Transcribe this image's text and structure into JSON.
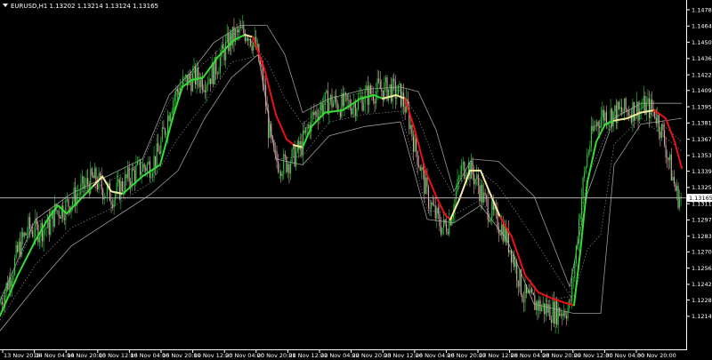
{
  "window": {
    "symbol_label": "EURUSD,H1  1.13202 1.13214 1.13124 1.13165"
  },
  "colors": {
    "background": "#000000",
    "axis": "#ffffff",
    "bull_candle": "#2ecc40",
    "bear_candle": "#d8a8a8",
    "trend_up": "#33dd33",
    "trend_flat": "#f2eca0",
    "trend_down": "#ee1111",
    "envelope": "#9a9a9a",
    "bid_line": "#b0b0b0"
  },
  "chart_data": {
    "type": "candlestick",
    "symbol": "EURUSD",
    "timeframe": "H1",
    "ohlc_header": {
      "open": 1.13202,
      "high": 1.13214,
      "low": 1.13124,
      "close": 1.13165
    },
    "price_ticks": [
      1.14785,
      1.14645,
      1.14505,
      1.14365,
      1.14225,
      1.1409,
      1.1395,
      1.1381,
      1.1367,
      1.1353,
      1.13395,
      1.13255,
      1.13115,
      1.12975,
      1.12835,
      1.127,
      1.1256,
      1.1242,
      1.12285,
      1.12145
    ],
    "time_labels": [
      "13 Nov 2018",
      "14 Nov 04:00",
      "14 Nov 20:00",
      "15 Nov 12:00",
      "16 Nov 04:00",
      "16 Nov 20:00",
      "19 Nov 12:00",
      "20 Nov 04:00",
      "20 Nov 20:00",
      "21 Nov 12:00",
      "22 Nov 04:00",
      "22 Nov 20:00",
      "23 Nov 12:00",
      "26 Nov 04:00",
      "26 Nov 20:00",
      "27 Nov 12:00",
      "28 Nov 04:00",
      "28 Nov 20:00",
      "29 Nov 12:00",
      "30 Nov 04:00",
      "30 Nov 20:00"
    ],
    "current_price": "1.13165",
    "close_path": [
      [
        0,
        1.1225
      ],
      [
        12,
        1.125
      ],
      [
        22,
        1.1275
      ],
      [
        32,
        1.129
      ],
      [
        40,
        1.1288
      ],
      [
        55,
        1.1292
      ],
      [
        62,
        1.1305
      ],
      [
        72,
        1.1308
      ],
      [
        85,
        1.1318
      ],
      [
        97,
        1.1328
      ],
      [
        105,
        1.1333
      ],
      [
        112,
        1.1328
      ],
      [
        118,
        1.1322
      ],
      [
        128,
        1.1318
      ],
      [
        140,
        1.133
      ],
      [
        150,
        1.1338
      ],
      [
        160,
        1.1343
      ],
      [
        170,
        1.1345
      ],
      [
        178,
        1.1355
      ],
      [
        185,
        1.1375
      ],
      [
        192,
        1.1398
      ],
      [
        200,
        1.141
      ],
      [
        210,
        1.1418
      ],
      [
        220,
        1.142
      ],
      [
        230,
        1.1418
      ],
      [
        240,
        1.1425
      ],
      [
        250,
        1.144
      ],
      [
        258,
        1.1452
      ],
      [
        268,
        1.1458
      ],
      [
        278,
        1.146
      ],
      [
        288,
        1.1445
      ],
      [
        296,
        1.1415
      ],
      [
        302,
        1.1375
      ],
      [
        308,
        1.135
      ],
      [
        318,
        1.1345
      ],
      [
        328,
        1.135
      ],
      [
        338,
        1.136
      ],
      [
        350,
        1.1385
      ],
      [
        360,
        1.1395
      ],
      [
        370,
        1.14
      ],
      [
        385,
        1.1396
      ],
      [
        400,
        1.1398
      ],
      [
        412,
        1.1405
      ],
      [
        425,
        1.141
      ],
      [
        438,
        1.141
      ],
      [
        450,
        1.1405
      ],
      [
        458,
        1.139
      ],
      [
        465,
        1.1365
      ],
      [
        472,
        1.1345
      ],
      [
        480,
        1.1318
      ],
      [
        490,
        1.13
      ],
      [
        498,
        1.129
      ],
      [
        505,
        1.1298
      ],
      [
        512,
        1.1318
      ],
      [
        518,
        1.134
      ],
      [
        525,
        1.1345
      ],
      [
        535,
        1.1332
      ],
      [
        545,
        1.1312
      ],
      [
        555,
        1.13
      ],
      [
        565,
        1.129
      ],
      [
        575,
        1.127
      ],
      [
        582,
        1.125
      ],
      [
        588,
        1.1232
      ],
      [
        596,
        1.1228
      ],
      [
        610,
        1.1222
      ],
      [
        625,
        1.1218
      ],
      [
        640,
        1.1222
      ],
      [
        646,
        1.1262
      ],
      [
        652,
        1.131
      ],
      [
        660,
        1.1355
      ],
      [
        668,
        1.1378
      ],
      [
        676,
        1.1388
      ],
      [
        684,
        1.1388
      ],
      [
        695,
        1.139
      ],
      [
        705,
        1.1392
      ],
      [
        715,
        1.1393
      ],
      [
        725,
        1.1395
      ],
      [
        735,
        1.1392
      ],
      [
        742,
        1.1378
      ],
      [
        748,
        1.136
      ],
      [
        754,
        1.134
      ],
      [
        760,
        1.132
      ],
      [
        766,
        1.1315
      ]
    ],
    "trend_line": [
      {
        "color": "up",
        "points": [
          [
            0,
            1.1215
          ],
          [
            20,
            1.125
          ],
          [
            40,
            1.128
          ],
          [
            55,
            1.13
          ],
          [
            65,
            1.131
          ],
          [
            75,
            1.1303
          ],
          [
            90,
            1.1315
          ],
          [
            105,
            1.1327
          ]
        ]
      },
      {
        "color": "flat",
        "points": [
          [
            105,
            1.1327
          ],
          [
            115,
            1.1335
          ],
          [
            125,
            1.1322
          ],
          [
            138,
            1.132
          ]
        ]
      },
      {
        "color": "up",
        "points": [
          [
            138,
            1.132
          ],
          [
            160,
            1.1335
          ],
          [
            180,
            1.1345
          ],
          [
            195,
            1.1388
          ],
          [
            205,
            1.1412
          ],
          [
            215,
            1.1418
          ],
          [
            228,
            1.142
          ],
          [
            245,
            1.1438
          ],
          [
            262,
            1.1452
          ],
          [
            275,
            1.1457
          ]
        ]
      },
      {
        "color": "flat",
        "points": [
          [
            275,
            1.1457
          ],
          [
            284,
            1.1455
          ]
        ]
      },
      {
        "color": "down",
        "points": [
          [
            284,
            1.1455
          ],
          [
            297,
            1.1428
          ],
          [
            310,
            1.1388
          ],
          [
            322,
            1.1367
          ],
          [
            330,
            1.1362
          ]
        ]
      },
      {
        "color": "flat",
        "points": [
          [
            330,
            1.1362
          ],
          [
            340,
            1.136
          ]
        ]
      },
      {
        "color": "up",
        "points": [
          [
            340,
            1.136
          ],
          [
            350,
            1.1378
          ],
          [
            365,
            1.139
          ],
          [
            385,
            1.1392
          ],
          [
            405,
            1.1402
          ],
          [
            420,
            1.1405
          ],
          [
            430,
            1.1402
          ]
        ]
      },
      {
        "color": "flat",
        "points": [
          [
            430,
            1.1402
          ],
          [
            445,
            1.1405
          ],
          [
            455,
            1.1402
          ]
        ]
      },
      {
        "color": "down",
        "points": [
          [
            455,
            1.1402
          ],
          [
            465,
            1.1378
          ],
          [
            478,
            1.134
          ],
          [
            490,
            1.1318
          ],
          [
            500,
            1.1302
          ],
          [
            506,
            1.1298
          ]
        ]
      },
      {
        "color": "flat",
        "points": [
          [
            506,
            1.1298
          ],
          [
            516,
            1.1315
          ],
          [
            528,
            1.134
          ],
          [
            540,
            1.134
          ],
          [
            552,
            1.1318
          ],
          [
            562,
            1.13
          ]
        ]
      },
      {
        "color": "down",
        "points": [
          [
            562,
            1.13
          ],
          [
            575,
            1.1283
          ],
          [
            590,
            1.125
          ],
          [
            605,
            1.1235
          ],
          [
            620,
            1.123
          ],
          [
            635,
            1.1226
          ],
          [
            645,
            1.1224
          ]
        ]
      },
      {
        "color": "up",
        "points": [
          [
            645,
            1.1224
          ],
          [
            652,
            1.127
          ],
          [
            660,
            1.133
          ],
          [
            670,
            1.1365
          ],
          [
            680,
            1.138
          ],
          [
            690,
            1.1383
          ]
        ]
      },
      {
        "color": "flat",
        "points": [
          [
            690,
            1.1383
          ],
          [
            705,
            1.1385
          ],
          [
            720,
            1.139
          ],
          [
            735,
            1.1392
          ]
        ]
      },
      {
        "color": "down",
        "points": [
          [
            735,
            1.1392
          ],
          [
            748,
            1.1385
          ],
          [
            758,
            1.1365
          ],
          [
            766,
            1.1342
          ]
        ]
      }
    ],
    "upper_envelope": [
      [
        0,
        1.1228
      ],
      [
        40,
        1.1298
      ],
      [
        80,
        1.132
      ],
      [
        120,
        1.1335
      ],
      [
        160,
        1.135
      ],
      [
        190,
        1.1405
      ],
      [
        215,
        1.1425
      ],
      [
        240,
        1.145
      ],
      [
        270,
        1.1465
      ],
      [
        300,
        1.1465
      ],
      [
        320,
        1.144
      ],
      [
        340,
        1.139
      ],
      [
        370,
        1.1402
      ],
      [
        410,
        1.141
      ],
      [
        450,
        1.1412
      ],
      [
        470,
        1.1408
      ],
      [
        490,
        1.1375
      ],
      [
        510,
        1.1322
      ],
      [
        530,
        1.135
      ],
      [
        560,
        1.1348
      ],
      [
        600,
        1.1318
      ],
      [
        640,
        1.124
      ],
      [
        660,
        1.132
      ],
      [
        690,
        1.1385
      ],
      [
        720,
        1.1398
      ],
      [
        766,
        1.1398
      ]
    ],
    "lower_envelope": [
      [
        0,
        1.1202
      ],
      [
        40,
        1.124
      ],
      [
        80,
        1.1275
      ],
      [
        120,
        1.1295
      ],
      [
        170,
        1.132
      ],
      [
        200,
        1.134
      ],
      [
        230,
        1.1385
      ],
      [
        260,
        1.142
      ],
      [
        290,
        1.144
      ],
      [
        310,
        1.135
      ],
      [
        340,
        1.1345
      ],
      [
        370,
        1.137
      ],
      [
        410,
        1.1378
      ],
      [
        450,
        1.1382
      ],
      [
        480,
        1.1298
      ],
      [
        510,
        1.1295
      ],
      [
        540,
        1.131
      ],
      [
        570,
        1.128
      ],
      [
        600,
        1.1225
      ],
      [
        645,
        1.1217
      ],
      [
        660,
        1.1217
      ],
      [
        675,
        1.1217
      ],
      [
        690,
        1.1345
      ],
      [
        720,
        1.138
      ],
      [
        766,
        1.1385
      ]
    ]
  }
}
